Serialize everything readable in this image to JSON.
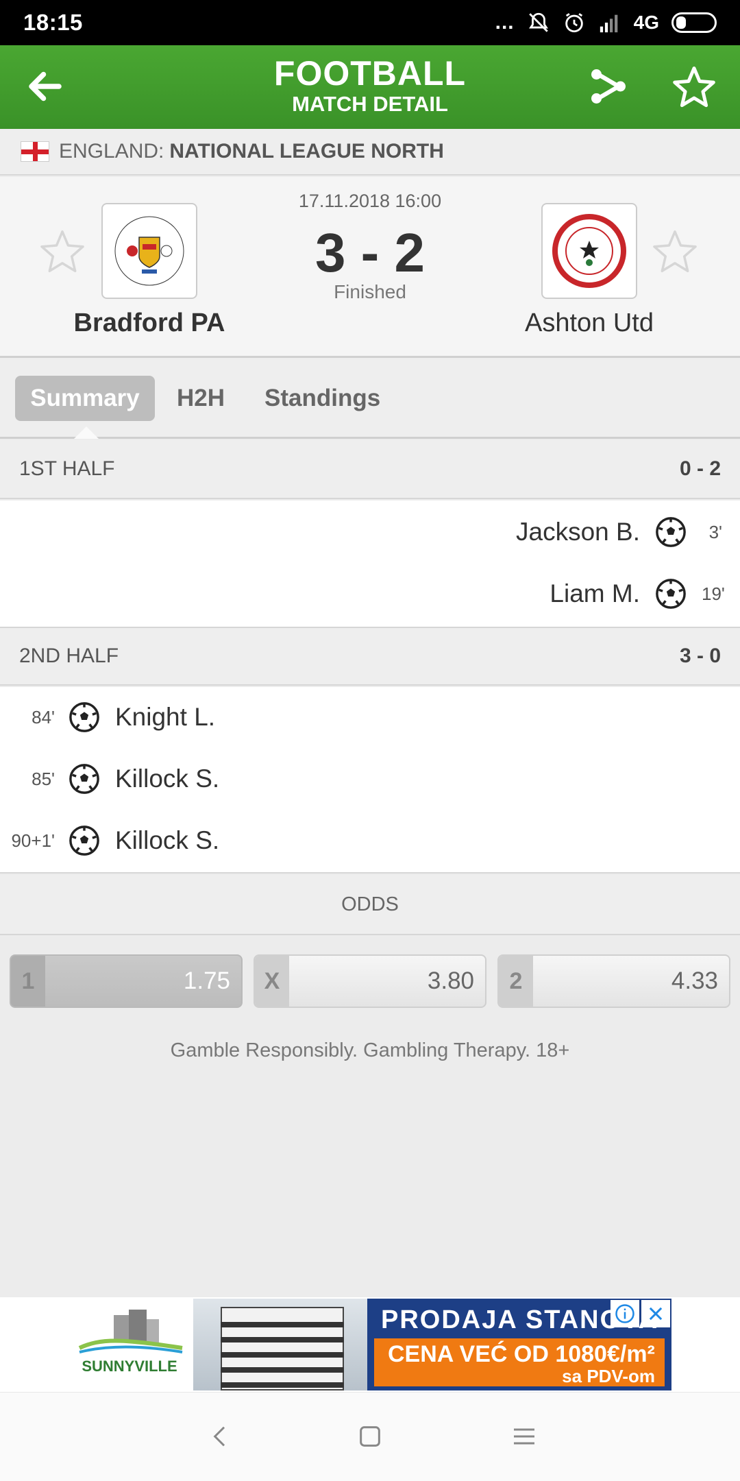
{
  "status_bar": {
    "time": "18:15",
    "network": "4G",
    "dots": "..."
  },
  "header": {
    "title": "FOOTBALL",
    "subtitle": "MATCH DETAIL"
  },
  "league": {
    "country": "ENGLAND:",
    "name": "NATIONAL LEAGUE NORTH"
  },
  "match": {
    "datetime": "17.11.2018 16:00",
    "score": "3 - 2",
    "status": "Finished",
    "home_team": "Bradford PA",
    "away_team": "Ashton Utd"
  },
  "tabs": [
    {
      "label": "Summary",
      "active": true
    },
    {
      "label": "H2H",
      "active": false
    },
    {
      "label": "Standings",
      "active": false
    }
  ],
  "summary": {
    "first_half": {
      "label": "1ST HALF",
      "score": "0 - 2",
      "events": [
        {
          "side": "away",
          "player": "Jackson B.",
          "minute": "3'"
        },
        {
          "side": "away",
          "player": "Liam M.",
          "minute": "19'"
        }
      ]
    },
    "second_half": {
      "label": "2ND HALF",
      "score": "3 - 0",
      "events": [
        {
          "side": "home",
          "player": "Knight L.",
          "minute": "84'"
        },
        {
          "side": "home",
          "player": "Killock S.",
          "minute": "85'"
        },
        {
          "side": "home",
          "player": "Killock S.",
          "minute": "90+1'"
        }
      ]
    }
  },
  "odds": {
    "title": "ODDS",
    "items": [
      {
        "label": "1",
        "value": "1.75"
      },
      {
        "label": "X",
        "value": "3.80"
      },
      {
        "label": "2",
        "value": "4.33"
      }
    ],
    "disclaimer": "Gamble Responsibly. Gambling Therapy. 18+"
  },
  "ad": {
    "brand": "SUNNYVILLE",
    "headline": "PRODAJA STANOVA",
    "offer": "CENA VEĆ OD 1080€/m²",
    "offer_note": "sa PDV-om"
  },
  "colors": {
    "header_green": "#3f9a2c",
    "ad_blue": "#1d3f86",
    "ad_orange": "#f07a12"
  }
}
